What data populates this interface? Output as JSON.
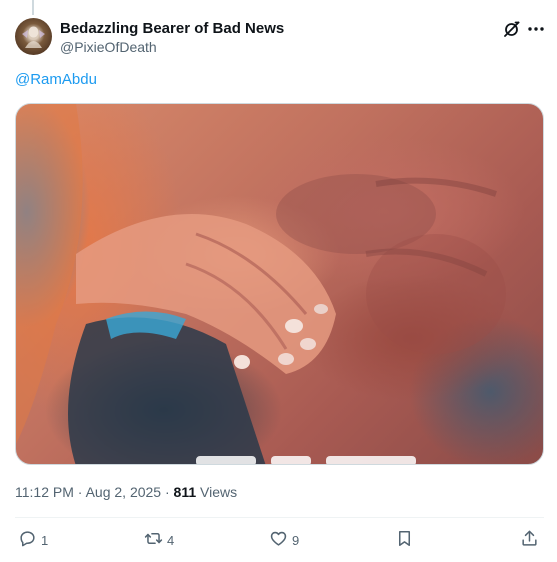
{
  "author": {
    "display_name": "Bedazzling Bearer of Bad News",
    "handle": "@PixieOfDeath"
  },
  "post": {
    "mention": "@RamAbdu"
  },
  "media": {
    "kind": "video-still",
    "dominant_colors": [
      "#c0715f",
      "#2c8cd2",
      "#2b3846"
    ]
  },
  "meta": {
    "time": "11:12 PM",
    "separator": "·",
    "date": "Aug 2, 2025",
    "views_count": "811",
    "views_label": "Views"
  },
  "actions": {
    "reply_count": "1",
    "repost_count": "4",
    "like_count": "9"
  },
  "icons": {
    "grok": "grok-icon",
    "more": "more-icon",
    "reply": "reply-icon",
    "repost": "repost-icon",
    "like": "heart-icon",
    "bookmark": "bookmark-icon",
    "share": "share-icon"
  },
  "colors": {
    "link": "#1d9bf0",
    "secondary_text": "#536471",
    "primary_text": "#0f1419"
  }
}
